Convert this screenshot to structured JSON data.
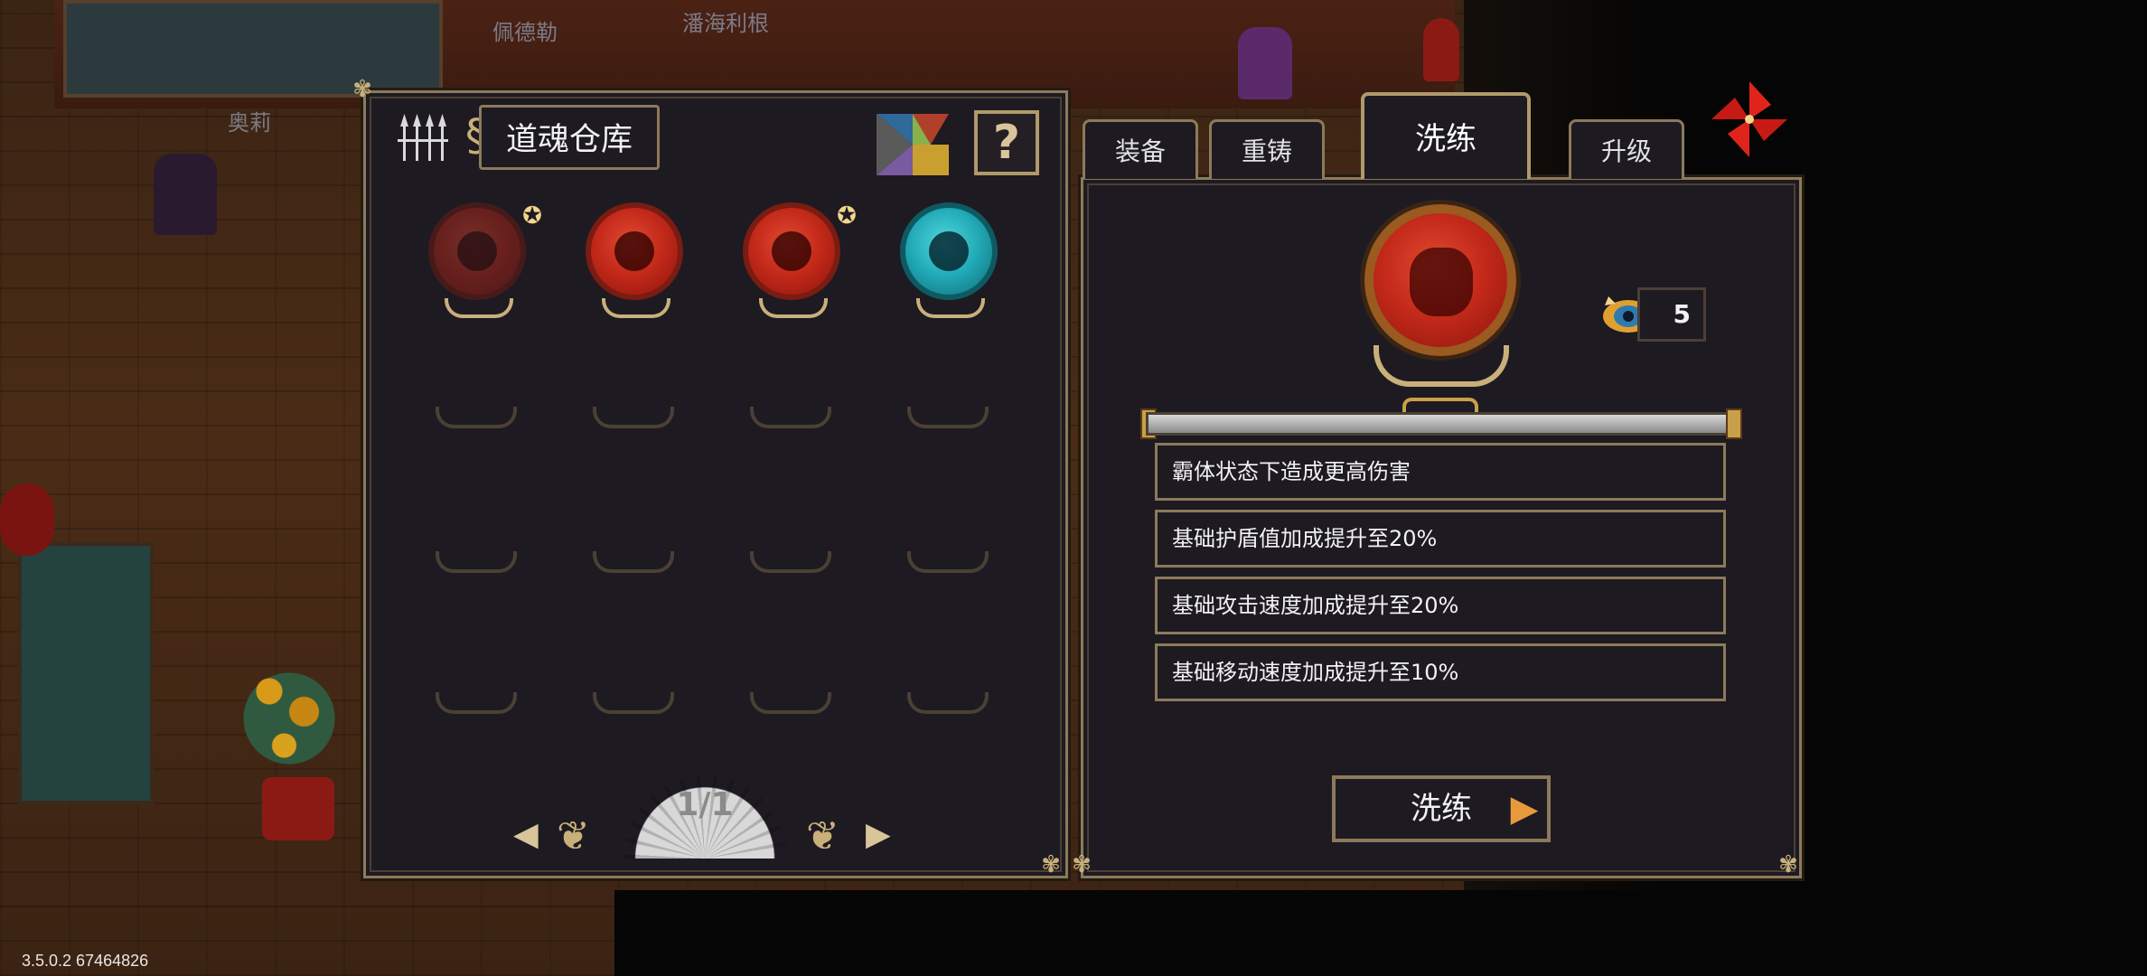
{
  "world": {
    "npc_names": [
      "佩德勒",
      "潘海利根",
      "奥莉"
    ]
  },
  "version": "3.5.0.2 67464826",
  "vault": {
    "title": "道魂仓库",
    "help_label": "?",
    "page_indicator": "1/1",
    "souls": [
      {
        "color": "red",
        "dimmed": true,
        "starred": true
      },
      {
        "color": "red",
        "dimmed": false,
        "starred": false
      },
      {
        "color": "red",
        "dimmed": false,
        "starred": true
      },
      {
        "color": "cyan",
        "dimmed": false,
        "starred": false
      }
    ],
    "empty_slot_count": 12
  },
  "tabs": [
    {
      "label": "装备",
      "active": false
    },
    {
      "label": "重铸",
      "active": false
    },
    {
      "label": "洗练",
      "active": true
    },
    {
      "label": "升级",
      "active": false
    }
  ],
  "refine": {
    "reroll_count": "5",
    "attributes": [
      "霸体状态下造成更高伤害",
      "基础护盾值加成提升至20%",
      "基础攻击速度加成提升至20%",
      "基础移动速度加成提升至10%"
    ],
    "button_label": "洗练"
  },
  "colors": {
    "panel_bg": "#1e1a22",
    "frame": "#8c7a5a",
    "soul_red": "#c52a1a",
    "soul_cyan": "#20a8b4",
    "gold": "#c9b07a"
  }
}
